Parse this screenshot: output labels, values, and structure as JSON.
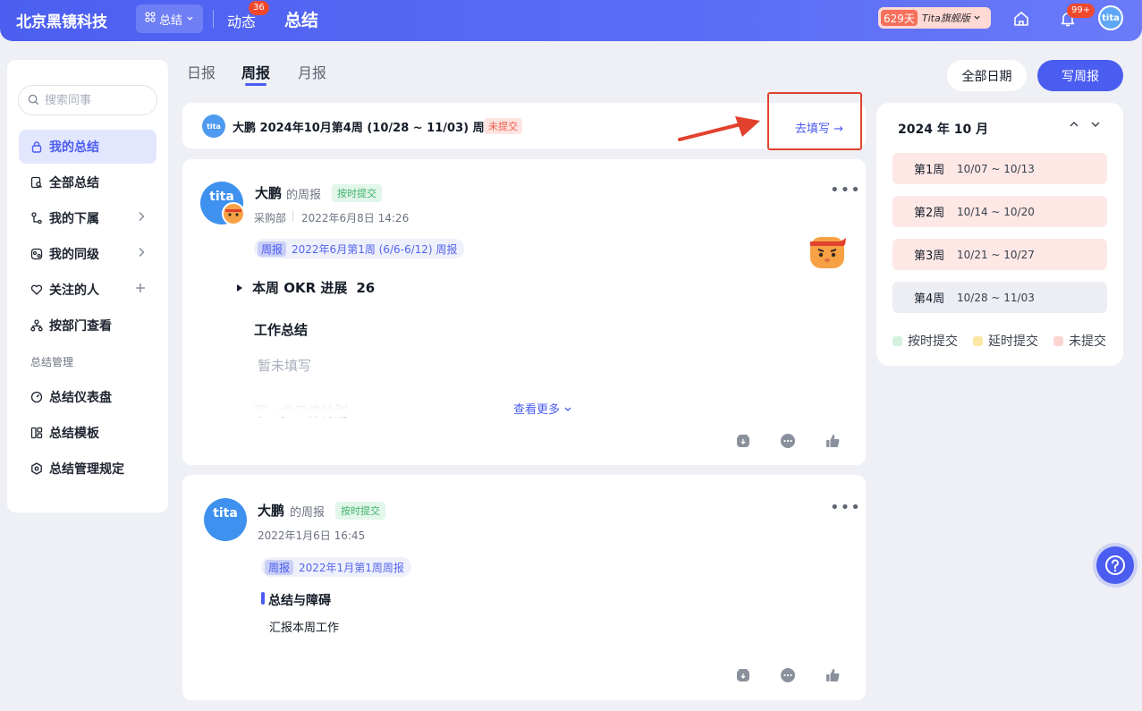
{
  "header": {
    "company": "北京黑镜科技",
    "module_switch": "总结",
    "nav_feed": "动态",
    "nav_feed_badge": "36",
    "current_page": "总结",
    "trial_days": "629天",
    "trial_version": "Tita旗舰版",
    "notifications_badge": "99+",
    "avatar_text": "tita"
  },
  "sidebar": {
    "search_placeholder": "搜索同事",
    "items": [
      {
        "label": "我的总结"
      },
      {
        "label": "全部总结"
      },
      {
        "label": "我的下属"
      },
      {
        "label": "我的同级"
      },
      {
        "label": "关注的人"
      },
      {
        "label": "按部门查看"
      }
    ],
    "section_label": "总结管理",
    "manage_items": [
      {
        "label": "总结仪表盘"
      },
      {
        "label": "总结模板"
      },
      {
        "label": "总结管理规定"
      }
    ]
  },
  "tabs": [
    {
      "label": "日报"
    },
    {
      "label": "周报"
    },
    {
      "label": "月报"
    }
  ],
  "actions": {
    "all_dates": "全部日期",
    "write_weekly": "写周报"
  },
  "notice": {
    "text": "大鹏 2024年10月第4周 (10/28 ~ 11/03) 周报",
    "status": "未提交",
    "action": "去填写 →",
    "avatar_text": "tita"
  },
  "cards": [
    {
      "name": "大鹏",
      "type": "的周报",
      "status": "按时提交",
      "dept": "采购部",
      "time": "2022年6月8日 14:26",
      "pill_kind": "周报",
      "pill_text": "2022年6月第1周 (6/6-6/12) 周报",
      "okr_title": "本周 OKR 进展",
      "okr_count": "26",
      "section_title": "工作总结",
      "empty_text": "暂未填写",
      "faded_title": "下一步工作计划",
      "see_more": "查看更多",
      "avatar_text": "tita"
    },
    {
      "name": "大鹏",
      "type": "的周报",
      "status": "按时提交",
      "time": "2022年1月6日 16:45",
      "pill_kind": "周报",
      "pill_text": "2022年1月第1周周报",
      "section_title": "总结与障碍",
      "body": "汇报本周工作",
      "avatar_text": "tita"
    }
  ],
  "calendar": {
    "title": "2024 年 10 月",
    "weeks": [
      {
        "label": "第1周",
        "range": "10/07 ~ 10/13",
        "status": "not_submitted"
      },
      {
        "label": "第2周",
        "range": "10/14 ~ 10/20",
        "status": "not_submitted"
      },
      {
        "label": "第3周",
        "range": "10/21 ~ 10/27",
        "status": "not_submitted"
      },
      {
        "label": "第4周",
        "range": "10/28 ~ 11/03",
        "status": "current"
      }
    ],
    "legend": [
      {
        "label": "按时提交",
        "color": "#d4f1de"
      },
      {
        "label": "延时提交",
        "color": "#fbe7a6"
      },
      {
        "label": "未提交",
        "color": "#fbd5d2"
      }
    ]
  },
  "colors": {
    "accent": "#4b5cf0",
    "not_submitted_bg": "#fde8e6",
    "current_week_bg": "#eceef4",
    "highlight_red": "#e2412e"
  }
}
